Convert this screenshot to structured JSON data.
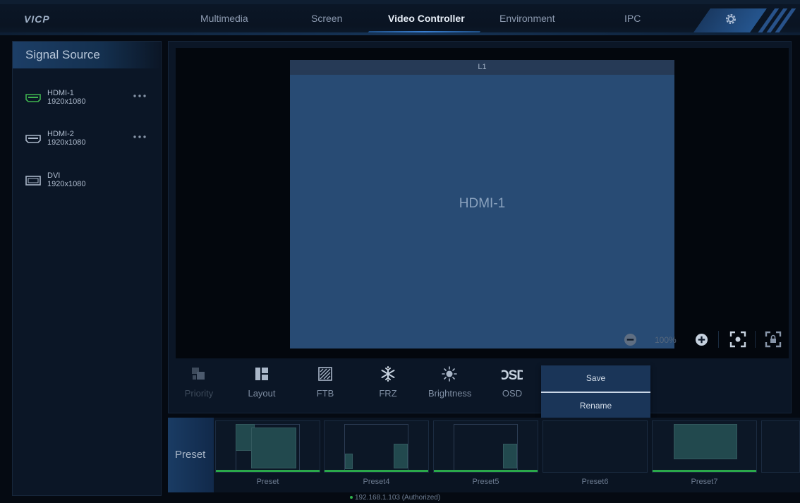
{
  "app": {
    "logo": "VICP"
  },
  "nav": {
    "tabs": [
      {
        "label": "Multimedia"
      },
      {
        "label": "Screen"
      },
      {
        "label": "Video Controller"
      },
      {
        "label": "Environment"
      },
      {
        "label": "IPC"
      }
    ],
    "active": "Video Controller"
  },
  "signal_source": {
    "title": "Signal Source",
    "items": [
      {
        "name": "HDMI-1",
        "resolution": "1920x1080",
        "icon": "hdmi-icon",
        "active": true
      },
      {
        "name": "HDMI-2",
        "resolution": "1920x1080",
        "icon": "hdmi-icon",
        "active": false
      },
      {
        "name": "DVI",
        "resolution": "1920x1080",
        "icon": "dvi-icon",
        "active": false
      }
    ]
  },
  "canvas": {
    "layer": {
      "header": "L1",
      "source": "HDMI-1"
    },
    "zoom": "100%"
  },
  "toolbar": {
    "items": [
      {
        "label": "Priority",
        "icon": "priority-icon",
        "disabled": true
      },
      {
        "label": "Layout",
        "icon": "layout-icon"
      },
      {
        "label": "FTB",
        "icon": "ftb-icon"
      },
      {
        "label": "FRZ",
        "icon": "snowflake-icon"
      },
      {
        "label": "Brightness",
        "icon": "brightness-icon"
      },
      {
        "label": "OSD",
        "icon": "osd-icon"
      }
    ]
  },
  "context_menu": {
    "items": [
      "Save",
      "Rename"
    ]
  },
  "presets": {
    "tab_label": "Preset",
    "items": [
      {
        "name": "Preset"
      },
      {
        "name": "Preset4"
      },
      {
        "name": "Preset5"
      },
      {
        "name": "Preset6"
      },
      {
        "name": "Preset7"
      }
    ]
  },
  "status": {
    "text": "192.168.1.103 (Authorized)"
  },
  "colors": {
    "accent": "#3a7fd1",
    "layer": "#284b74",
    "preset_active": "#2aa84a",
    "hdmi_active": "#3fb34f"
  }
}
